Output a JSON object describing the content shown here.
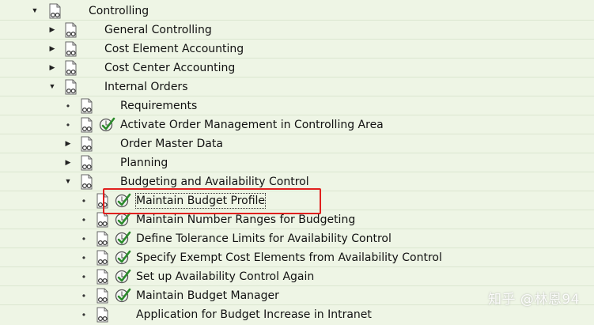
{
  "tree": {
    "items": [
      {
        "label": "Controlling",
        "expand": "expanded"
      },
      {
        "label": "General Controlling",
        "expand": "collapsed"
      },
      {
        "label": "Cost Element Accounting",
        "expand": "collapsed"
      },
      {
        "label": "Cost Center Accounting",
        "expand": "collapsed"
      },
      {
        "label": "Internal Orders",
        "expand": "expanded"
      },
      {
        "label": "Requirements",
        "expand": "leaf"
      },
      {
        "label": "Activate Order Management in Controlling Area",
        "expand": "leaf"
      },
      {
        "label": "Order Master Data",
        "expand": "collapsed"
      },
      {
        "label": "Planning",
        "expand": "collapsed"
      },
      {
        "label": "Budgeting and Availability Control",
        "expand": "expanded"
      },
      {
        "label": "Maintain Budget Profile",
        "expand": "leaf"
      },
      {
        "label": "Maintain Number Ranges for Budgeting",
        "expand": "leaf"
      },
      {
        "label": "Define Tolerance Limits for Availability Control",
        "expand": "leaf"
      },
      {
        "label": "Specify Exempt Cost Elements from Availability Control",
        "expand": "leaf"
      },
      {
        "label": "Set up Availability Control Again",
        "expand": "leaf"
      },
      {
        "label": "Maintain Budget Manager",
        "expand": "leaf"
      },
      {
        "label": "Application for Budget Increase in Intranet",
        "expand": "leaf"
      }
    ]
  },
  "icons": {
    "doc": "documentation-glasses-icon",
    "exec": "execute-checkmark-clock-icon",
    "expanded": "triangle-down-icon",
    "collapsed": "triangle-right-icon",
    "leaf": "bullet-dot-icon"
  },
  "colors": {
    "background": "#eef5e5",
    "highlight_border": "#e0201e",
    "check_green": "#2a8a2a"
  },
  "watermark": {
    "text": "知乎 @林恩94"
  }
}
